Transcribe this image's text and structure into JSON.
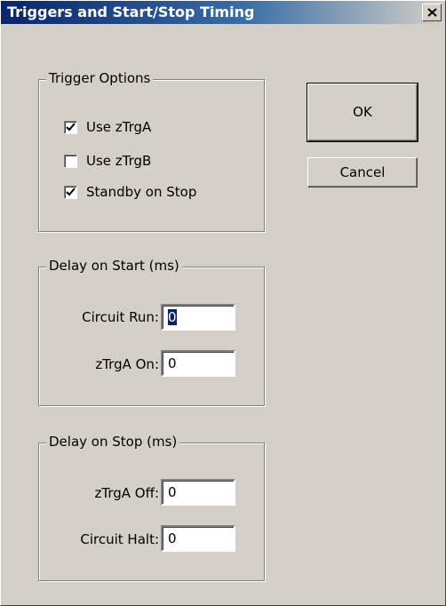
{
  "window": {
    "title": "Triggers and Start/Stop Timing"
  },
  "trigger_options": {
    "label": "Trigger Options",
    "items": [
      {
        "label": "Use zTrgA",
        "checked": true
      },
      {
        "label": "Use zTrgB",
        "checked": false
      },
      {
        "label": "Standby on Stop",
        "checked": true
      }
    ]
  },
  "delay_start": {
    "label": "Delay on Start (ms)",
    "circuit_run": {
      "label": "Circuit Run:",
      "value": "0"
    },
    "ztrga_on": {
      "label": "zTrgA On:",
      "value": "0"
    }
  },
  "delay_stop": {
    "label": "Delay on Stop (ms)",
    "ztrga_off": {
      "label": "zTrgA Off:",
      "value": "0"
    },
    "circuit_halt": {
      "label": "Circuit Halt:",
      "value": "0"
    }
  },
  "buttons": {
    "ok": "OK",
    "cancel": "Cancel"
  }
}
